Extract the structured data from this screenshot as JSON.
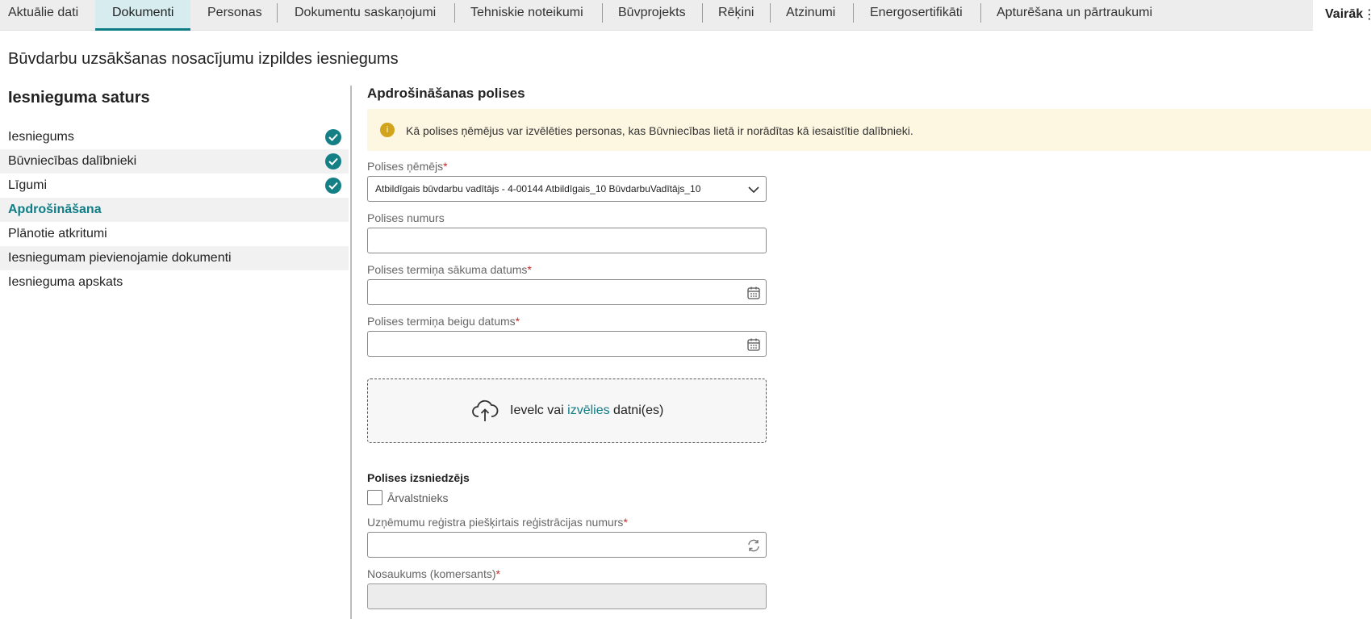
{
  "tabs": [
    {
      "label": "Aktuālie dati"
    },
    {
      "label": "Dokumenti",
      "active": true
    },
    {
      "label": "Personas"
    },
    {
      "label": "Dokumentu saskaņojumi"
    },
    {
      "label": "Tehniskie noteikumi"
    },
    {
      "label": "Būvprojekts"
    },
    {
      "label": "Rēķini"
    },
    {
      "label": "Atzinumi"
    },
    {
      "label": "Energosertifikāti"
    },
    {
      "label": "Apturēšana un pārtraukumi"
    }
  ],
  "more": {
    "label": "Vairāk",
    "icon": "more-dots-icon"
  },
  "page_title": "Būvdarbu uzsākšanas nosacījumu izpildes iesniegums",
  "sidebar": {
    "title": "Iesnieguma saturs",
    "items": [
      {
        "label": "Iesniegums",
        "done": true
      },
      {
        "label": "Būvniecības dalībnieki",
        "done": true
      },
      {
        "label": "Līgumi",
        "done": true
      },
      {
        "label": "Apdrošināšana",
        "current": true
      },
      {
        "label": "Plānotie atkritumi"
      },
      {
        "label": "Iesniegumam pievienojamie dokumenti"
      },
      {
        "label": "Iesnieguma apskats"
      }
    ]
  },
  "main": {
    "section_title": "Apdrošināšanas polises",
    "info_text": "Kā polises ņēmējus var izvēlēties personas, kas Būvniecības lietā ir norādītas kā iesaistītie dalībnieki.",
    "info_icon": "info-icon",
    "fields": {
      "policy_holder": {
        "label": "Polises ņēmējs",
        "required": "*",
        "value": "Atbildīgais būvdarbu vadītājs - 4-00144 Atbildīgais_10 BūvdarbuVadītājs_10"
      },
      "policy_number": {
        "label": "Polises numurs",
        "value": ""
      },
      "start_date": {
        "label": "Polises termiņa sākuma datums",
        "required": "*",
        "value": ""
      },
      "end_date": {
        "label": "Polises termiņa beigu datums",
        "required": "*",
        "value": ""
      },
      "reg_number": {
        "label": "Uzņēmumu reģistra piešķirtais reģistrācijas numurs",
        "required": "*",
        "value": ""
      },
      "company_name": {
        "label": "Nosaukums (komersants)",
        "required": "*",
        "value": ""
      }
    },
    "upload": {
      "prefix": "Ievelc vai ",
      "link": "izvēlies",
      "suffix": " datni(es)"
    },
    "issuer_title": "Polises izsniedzējs",
    "foreigner_label": "Ārvalstnieks"
  },
  "colors": {
    "accent": "#0f7d85",
    "check": "#157f86",
    "info_bg": "#fdf6e0",
    "info_icon": "#d2a41b",
    "tabbar": "#ededed"
  }
}
